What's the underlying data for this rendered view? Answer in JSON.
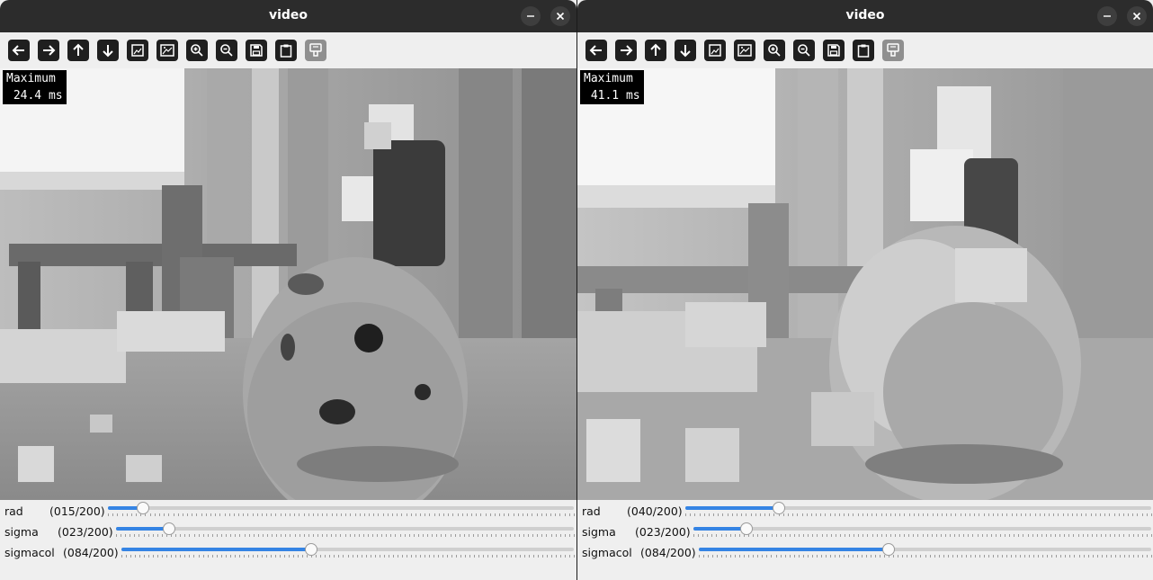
{
  "windows": [
    {
      "title": "video",
      "overlay": {
        "line1": "Maximum",
        "line2": " 24.4 ms"
      },
      "trackbars": [
        {
          "name": "rad",
          "display": "(015/200)",
          "value": 15,
          "max": 200
        },
        {
          "name": "sigma",
          "display": "(023/200)",
          "value": 23,
          "max": 200
        },
        {
          "name": "sigmacol",
          "display": "(084/200)",
          "value": 84,
          "max": 200
        }
      ]
    },
    {
      "title": "video",
      "overlay": {
        "line1": "Maximum",
        "line2": " 41.1 ms"
      },
      "trackbars": [
        {
          "name": "rad",
          "display": "(040/200)",
          "value": 40,
          "max": 200
        },
        {
          "name": "sigma",
          "display": "(023/200)",
          "value": 23,
          "max": 200
        },
        {
          "name": "sigmacol",
          "display": "(084/200)",
          "value": 84,
          "max": 200
        }
      ]
    }
  ],
  "toolbar_icons": [
    "arrow-left-icon",
    "arrow-right-icon",
    "arrow-up-icon",
    "arrow-down-icon",
    "zoom-reset-icon",
    "zoom-fit-icon",
    "zoom-in-icon",
    "zoom-out-icon",
    "save-icon",
    "copy-clipboard-icon",
    "properties-icon"
  ],
  "colors": {
    "titlebar": "#2c2c2c",
    "accent": "#3584e4",
    "panel": "#efefef"
  }
}
